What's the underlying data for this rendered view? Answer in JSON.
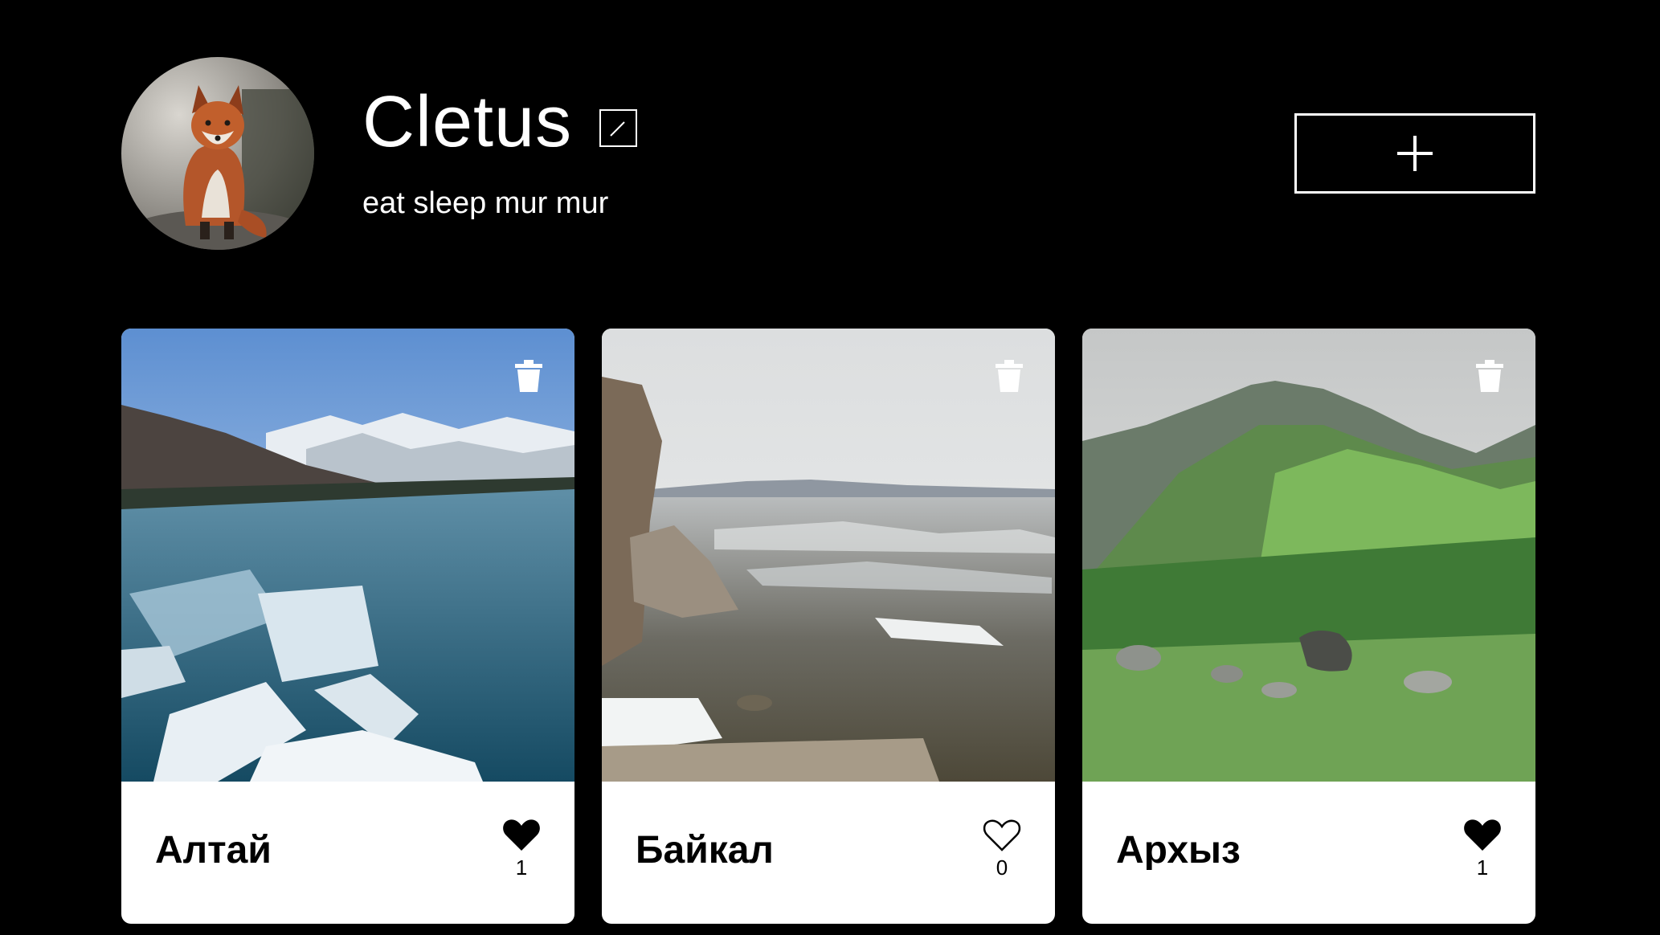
{
  "profile": {
    "name": "Cletus",
    "about": "eat sleep mur mur",
    "avatar_icon": "fox-photo"
  },
  "toolbar": {
    "edit_icon": "pencil-icon",
    "add_icon": "plus-icon"
  },
  "cards": [
    {
      "title": "Алтай",
      "likes": "1",
      "liked": true,
      "image": "frozen-river-mountains"
    },
    {
      "title": "Байкал",
      "likes": "0",
      "liked": false,
      "image": "lake-with-ice-rocks"
    },
    {
      "title": "Архыз",
      "likes": "1",
      "liked": true,
      "image": "green-mountain-valley"
    }
  ],
  "colors": {
    "page_background": "#000000",
    "card_background": "#ffffff",
    "text_primary": "#ffffff",
    "text_card": "#000000"
  }
}
